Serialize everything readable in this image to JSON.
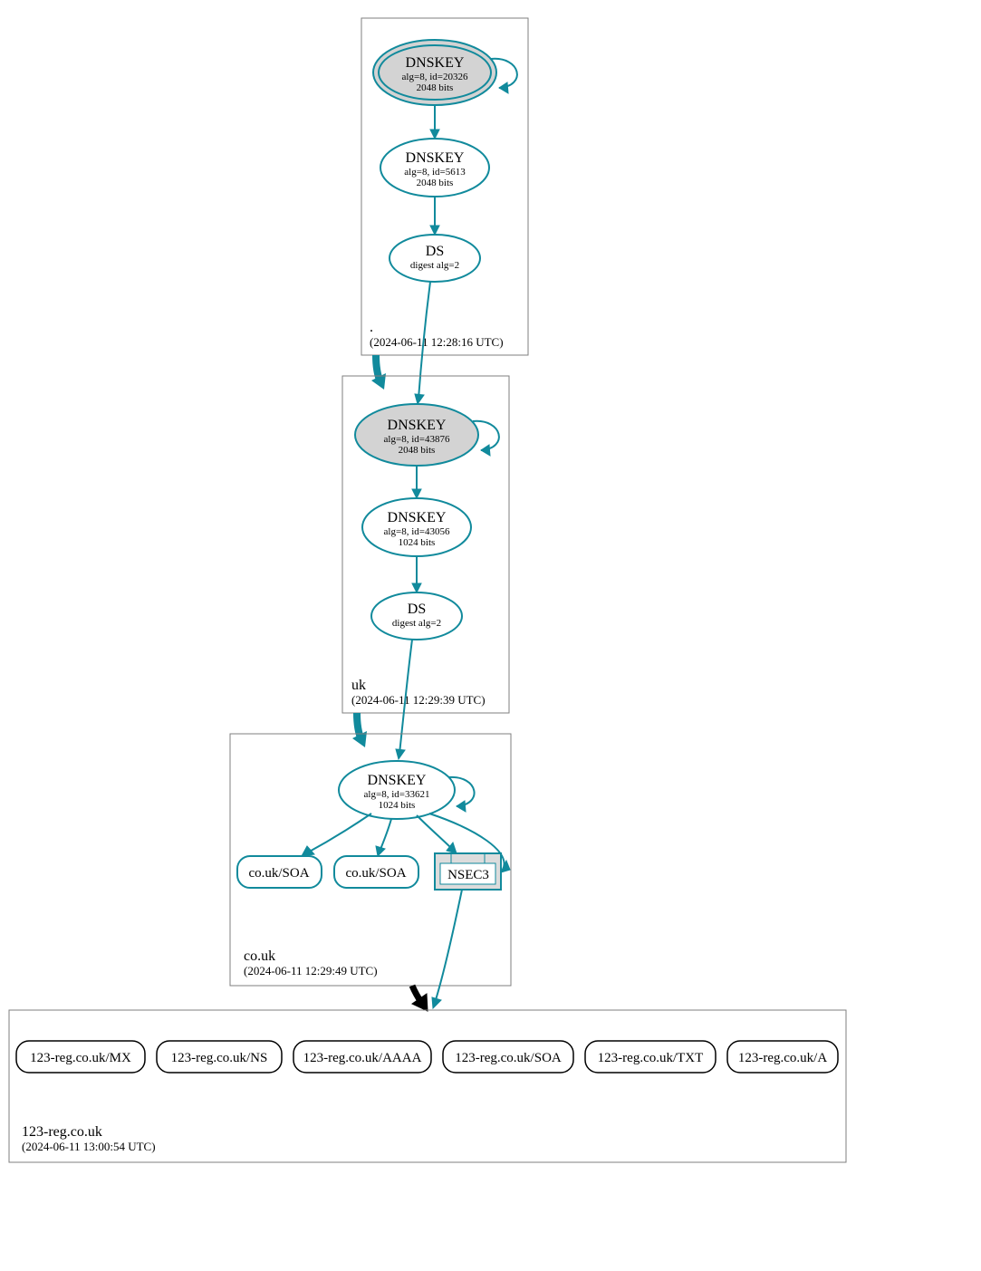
{
  "colors": {
    "teal": "#118a9c",
    "gray_fill": "#d3d3d3",
    "gray_box": "#7f7f7f"
  },
  "zones": {
    "root": {
      "name": ".",
      "timestamp": "(2024-06-11 12:28:16 UTC)",
      "nodes": {
        "ksk": {
          "title": "DNSKEY",
          "line1": "alg=8, id=20326",
          "line2": "2048 bits"
        },
        "zsk": {
          "title": "DNSKEY",
          "line1": "alg=8, id=5613",
          "line2": "2048 bits"
        },
        "ds": {
          "title": "DS",
          "line1": "digest alg=2"
        }
      }
    },
    "uk": {
      "name": "uk",
      "timestamp": "(2024-06-11 12:29:39 UTC)",
      "nodes": {
        "ksk": {
          "title": "DNSKEY",
          "line1": "alg=8, id=43876",
          "line2": "2048 bits"
        },
        "zsk": {
          "title": "DNSKEY",
          "line1": "alg=8, id=43056",
          "line2": "1024 bits"
        },
        "ds": {
          "title": "DS",
          "line1": "digest alg=2"
        }
      }
    },
    "couk": {
      "name": "co.uk",
      "timestamp": "(2024-06-11 12:29:49 UTC)",
      "nodes": {
        "zsk": {
          "title": "DNSKEY",
          "line1": "alg=8, id=33621",
          "line2": "1024 bits"
        },
        "soa1": {
          "label": "co.uk/SOA"
        },
        "soa2": {
          "label": "co.uk/SOA"
        },
        "nsec": {
          "label": "NSEC3"
        }
      }
    },
    "domain": {
      "name": "123-reg.co.uk",
      "timestamp": "(2024-06-11 13:00:54 UTC)",
      "records": {
        "mx": {
          "label": "123-reg.co.uk/MX"
        },
        "ns": {
          "label": "123-reg.co.uk/NS"
        },
        "aaaa": {
          "label": "123-reg.co.uk/AAAA"
        },
        "soa": {
          "label": "123-reg.co.uk/SOA"
        },
        "txt": {
          "label": "123-reg.co.uk/TXT"
        },
        "a": {
          "label": "123-reg.co.uk/A"
        }
      }
    }
  }
}
